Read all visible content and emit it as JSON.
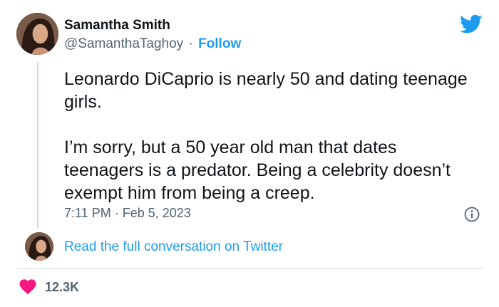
{
  "author": {
    "name": "Samantha Smith",
    "handle": "@SamanthaTaghoy",
    "separator": "·",
    "follow_label": "Follow"
  },
  "tweet": {
    "paragraphs": [
      "Leonardo DiCaprio is nearly 50 and dating teenage girls.",
      "I’m sorry, but a 50 year old man that dates teenagers is a predator. Being a celebrity doesn’t exempt him from being a creep."
    ],
    "timestamp": "7:11 PM · Feb 5, 2023"
  },
  "conversation_link": "Read the full conversation on Twitter",
  "likes": {
    "count": "12.3K"
  },
  "icons": {
    "logo": "twitter-bird-icon",
    "info": "info-icon",
    "like": "heart-icon"
  },
  "colors": {
    "brand": "#1d9bf0",
    "like": "#f91880",
    "text_primary": "#0f1419",
    "text_secondary": "#536471",
    "border": "#cfd9de"
  }
}
